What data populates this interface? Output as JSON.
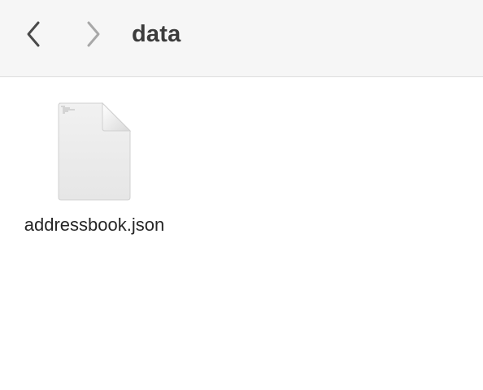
{
  "window": {
    "folder_title": "data"
  },
  "toolbar": {
    "back_icon": "chevron-left-icon",
    "forward_icon": "chevron-right-icon"
  },
  "files": [
    {
      "name": "addressbook.json",
      "icon": "document-icon"
    }
  ],
  "colors": {
    "toolbar_bg": "#f6f6f6",
    "title_text": "#3c3c3c",
    "label_text": "#262626"
  }
}
